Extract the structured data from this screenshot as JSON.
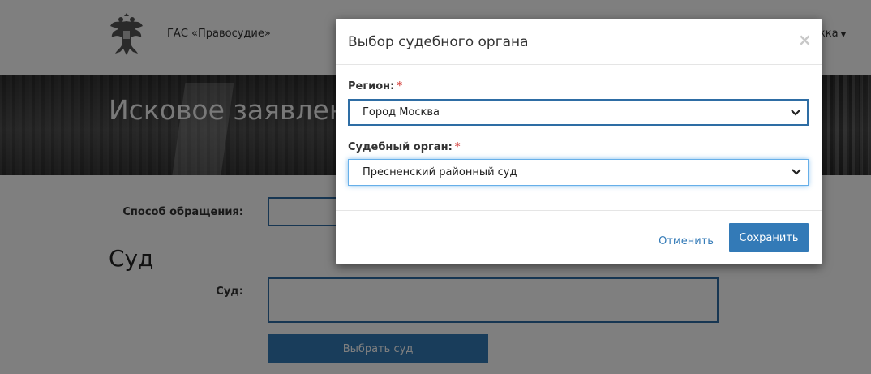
{
  "header": {
    "brand": "ГАС «Правосудие»",
    "help_menu_label": "жка",
    "help_menu_icon": "caret-down-icon",
    "emblem_icon": "double-headed-eagle-icon"
  },
  "banner": {
    "title": "Исковое заявлен"
  },
  "form": {
    "method_label": "Способ обращения:",
    "section_title": "Суд",
    "court_label": "Суд:",
    "choose_court_button": "Выбрать суд"
  },
  "modal": {
    "title": "Выбор судебного органа",
    "close_symbol": "×",
    "region": {
      "label": "Регион:",
      "required_mark": "*",
      "selected": "Город Москва"
    },
    "court_organ": {
      "label": "Судебный орган:",
      "required_mark": "*",
      "selected": "Пресненский районный суд"
    },
    "cancel_label": "Отменить",
    "save_label": "Сохранить"
  },
  "colors": {
    "primary": "#337ab7",
    "required": "#d9534f",
    "backdrop": "rgba(0,0,0,0.5)"
  }
}
